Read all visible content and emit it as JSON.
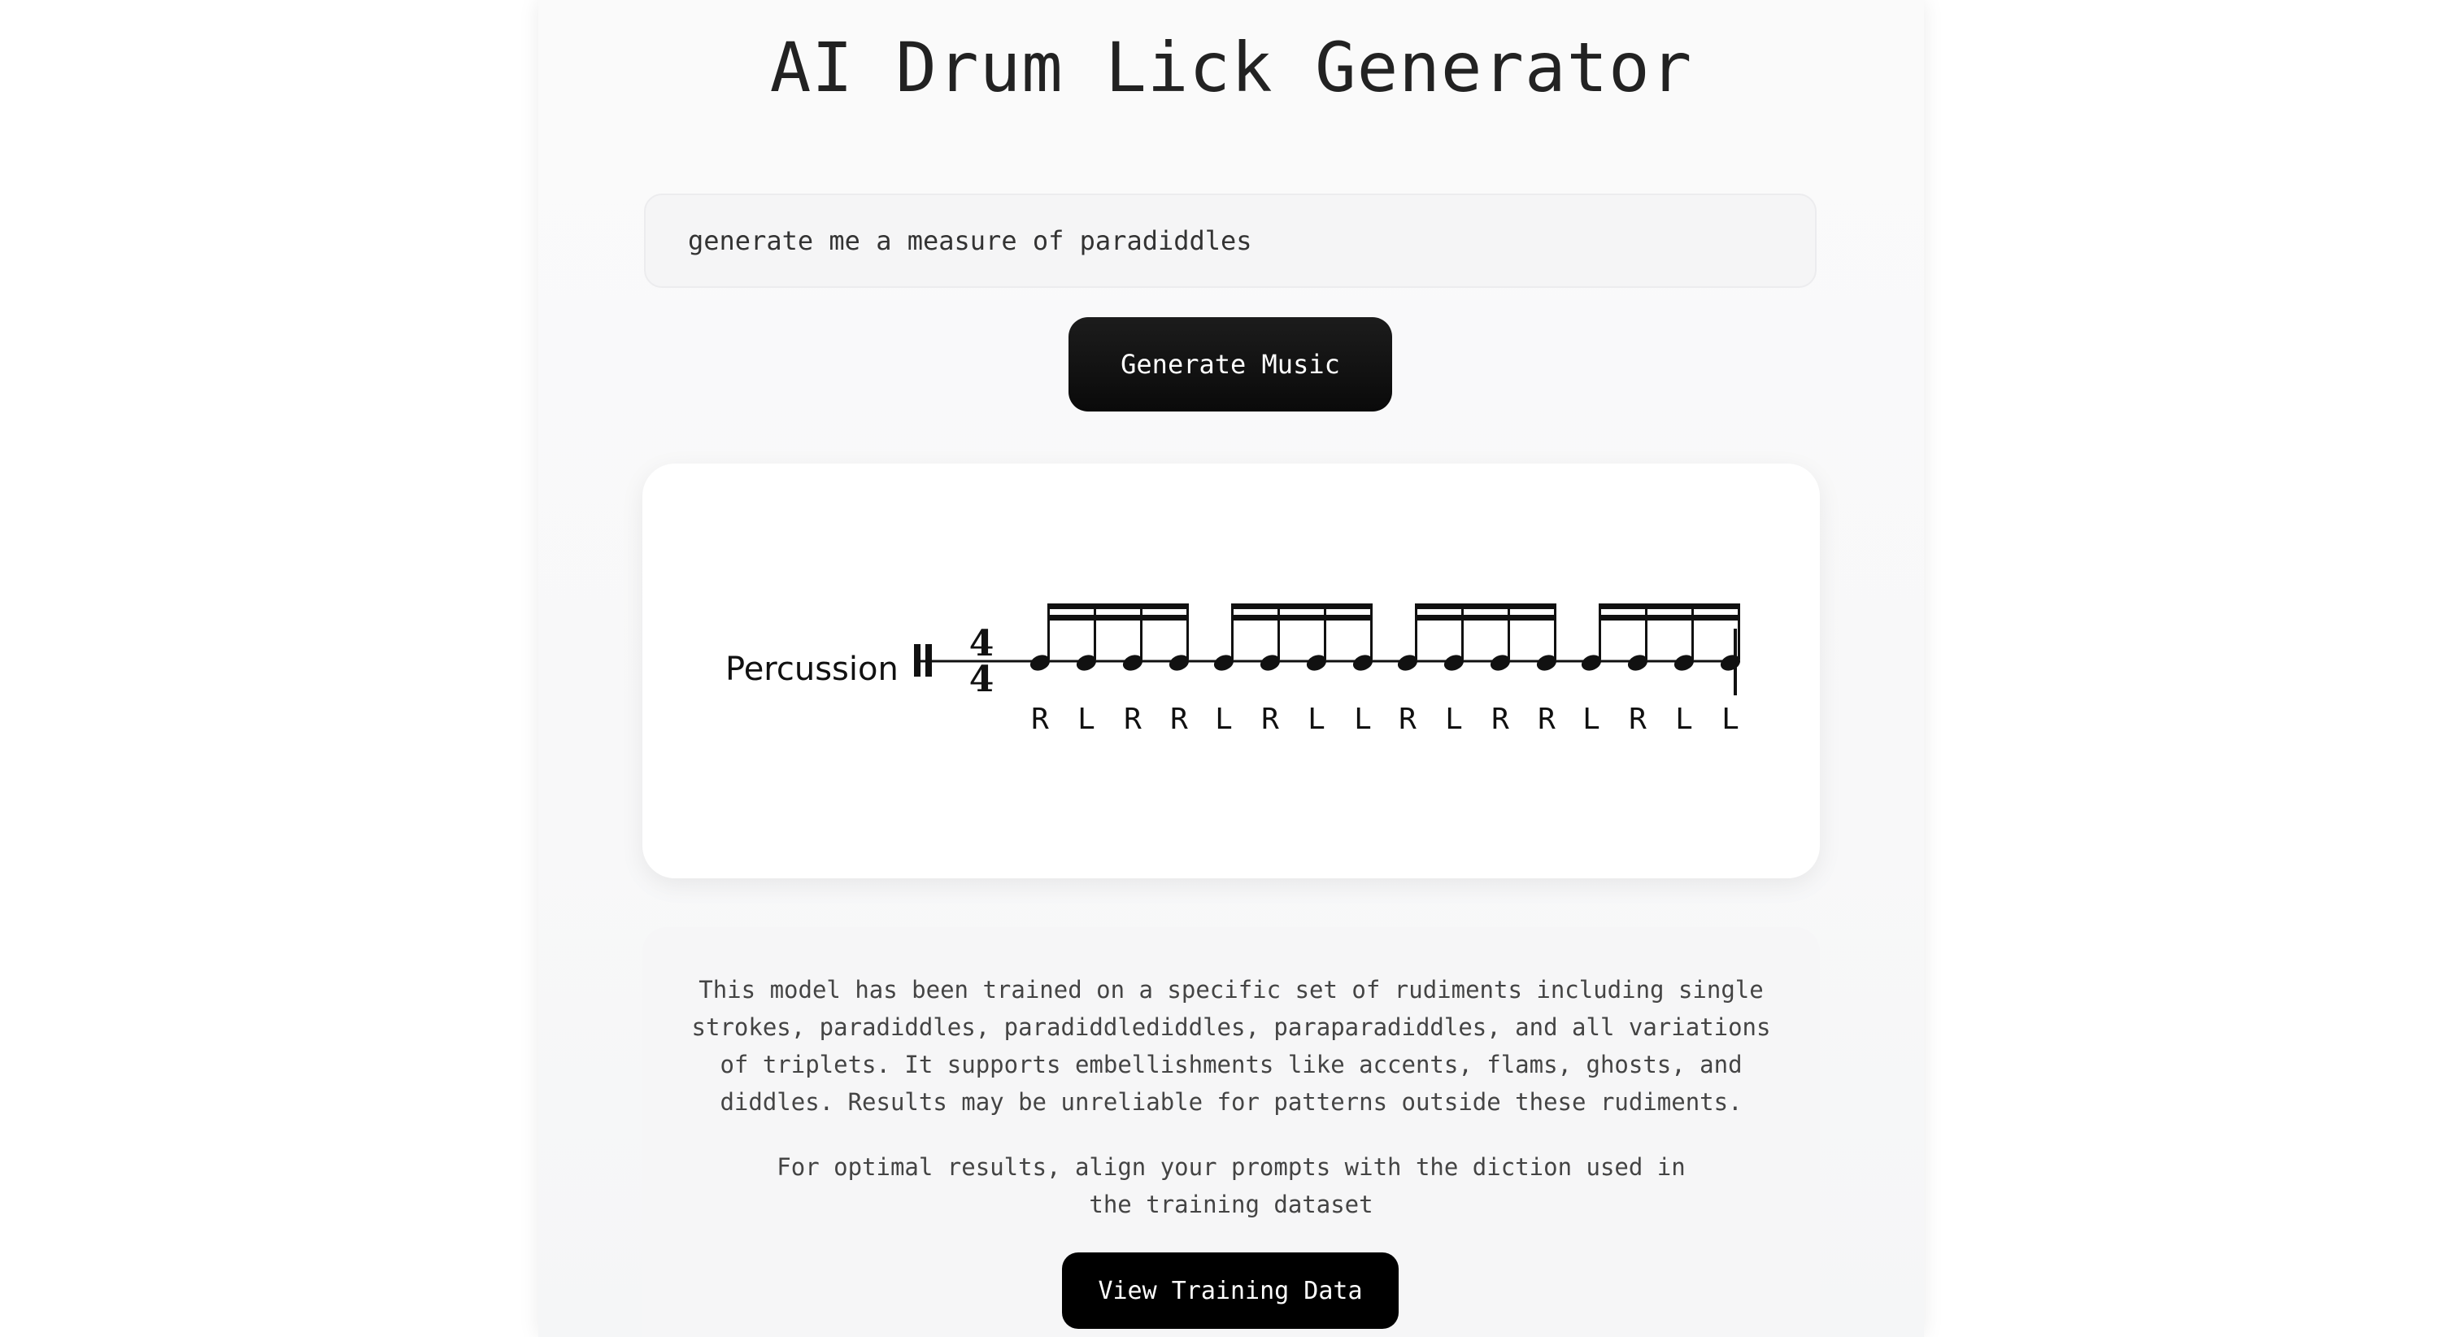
{
  "header": {
    "title": "AI Drum Lick Generator"
  },
  "prompt": {
    "value": "generate me a measure of paradiddles"
  },
  "generate_button": {
    "label": "Generate Music"
  },
  "score": {
    "instrument": "Percussion",
    "time_signature": {
      "numerator": "4",
      "denominator": "4"
    },
    "beat_groups": 4,
    "notes_per_group": 4,
    "sticking": [
      "R",
      "L",
      "R",
      "R",
      "L",
      "R",
      "L",
      "L",
      "R",
      "L",
      "R",
      "R",
      "L",
      "R",
      "L",
      "L"
    ]
  },
  "info": {
    "paragraph1": "This model has been trained on a specific set of rudiments including single strokes, paradiddles, paradiddlediddles, paraparadiddles, and all variations of triplets. It supports embellishments like accents, flams, ghosts, and diddles. Results may be unreliable for patterns outside these rudiments.",
    "paragraph2": "For optimal results, align your prompts with the diction used in the training dataset",
    "view_button": "View Training Data"
  }
}
